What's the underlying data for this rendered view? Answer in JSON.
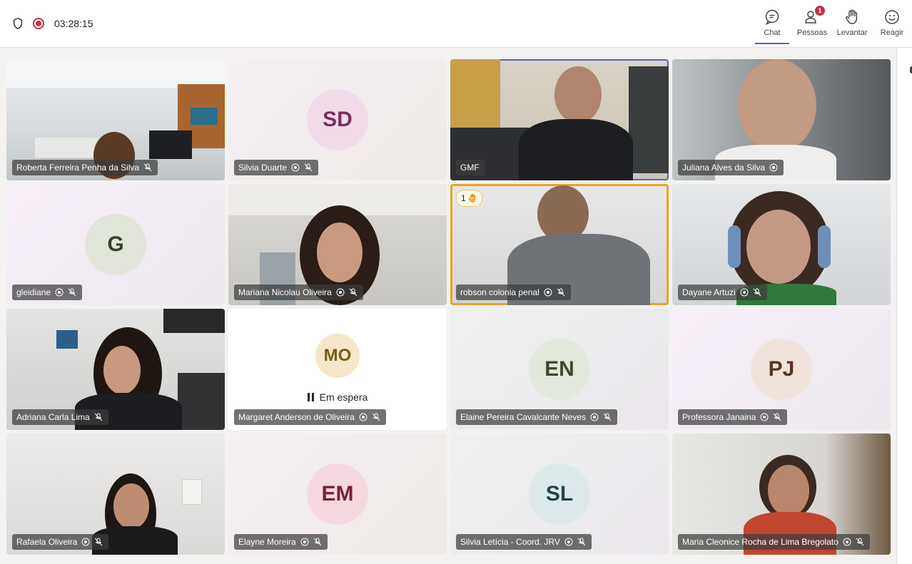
{
  "meeting": {
    "timer": "03:28:15"
  },
  "toolbar": {
    "chat": "Chat",
    "people": "Pessoas",
    "people_badge": "1",
    "raise": "Levantar",
    "react": "Reagir"
  },
  "participants": [
    {
      "name": "Roberta Ferreira Penha da Silva",
      "video": true
    },
    {
      "name": "Silvia Duarte",
      "initials": "SD",
      "video": false
    },
    {
      "name": "GMF",
      "video": true
    },
    {
      "name": "Juliana Alves da Silva",
      "video": true
    },
    {
      "name": "gleidiane",
      "initials": "G",
      "video": false
    },
    {
      "name": "Mariana Nicolau Oliveira",
      "video": true
    },
    {
      "name": "robson colonia penal",
      "video": true,
      "hand_raised": "1"
    },
    {
      "name": "Dayane Artuzi",
      "video": true
    },
    {
      "name": "Adriana Carla Lima",
      "video": true
    },
    {
      "name": "Margaret Anderson de Oliveira",
      "initials": "MO",
      "video": false,
      "status": "Em espera"
    },
    {
      "name": "Elaine Pereira Cavalcante Neves",
      "initials": "EN",
      "video": false
    },
    {
      "name": "Professora Janaina",
      "initials": "PJ",
      "video": false
    },
    {
      "name": "Rafaela Oliveira",
      "video": true
    },
    {
      "name": "Elayne Moreira",
      "initials": "EM",
      "video": false
    },
    {
      "name": "Silvia Letícia - Coord. JRV",
      "initials": "SL",
      "video": false
    },
    {
      "name": "Maria Cleonice Rocha de Lima Bregolato",
      "video": true
    }
  ],
  "colors": {
    "accent": "#5b5fc7",
    "record": "#c4314b",
    "raised_hand_border": "#e8a525"
  },
  "icons": {
    "shield": "shield-icon",
    "record": "recording-icon",
    "chat": "chat-icon",
    "people": "people-icon",
    "raise": "hand-icon",
    "react": "smiley-icon",
    "mic_off": "mic-off-icon",
    "pinned": "pin-icon"
  }
}
